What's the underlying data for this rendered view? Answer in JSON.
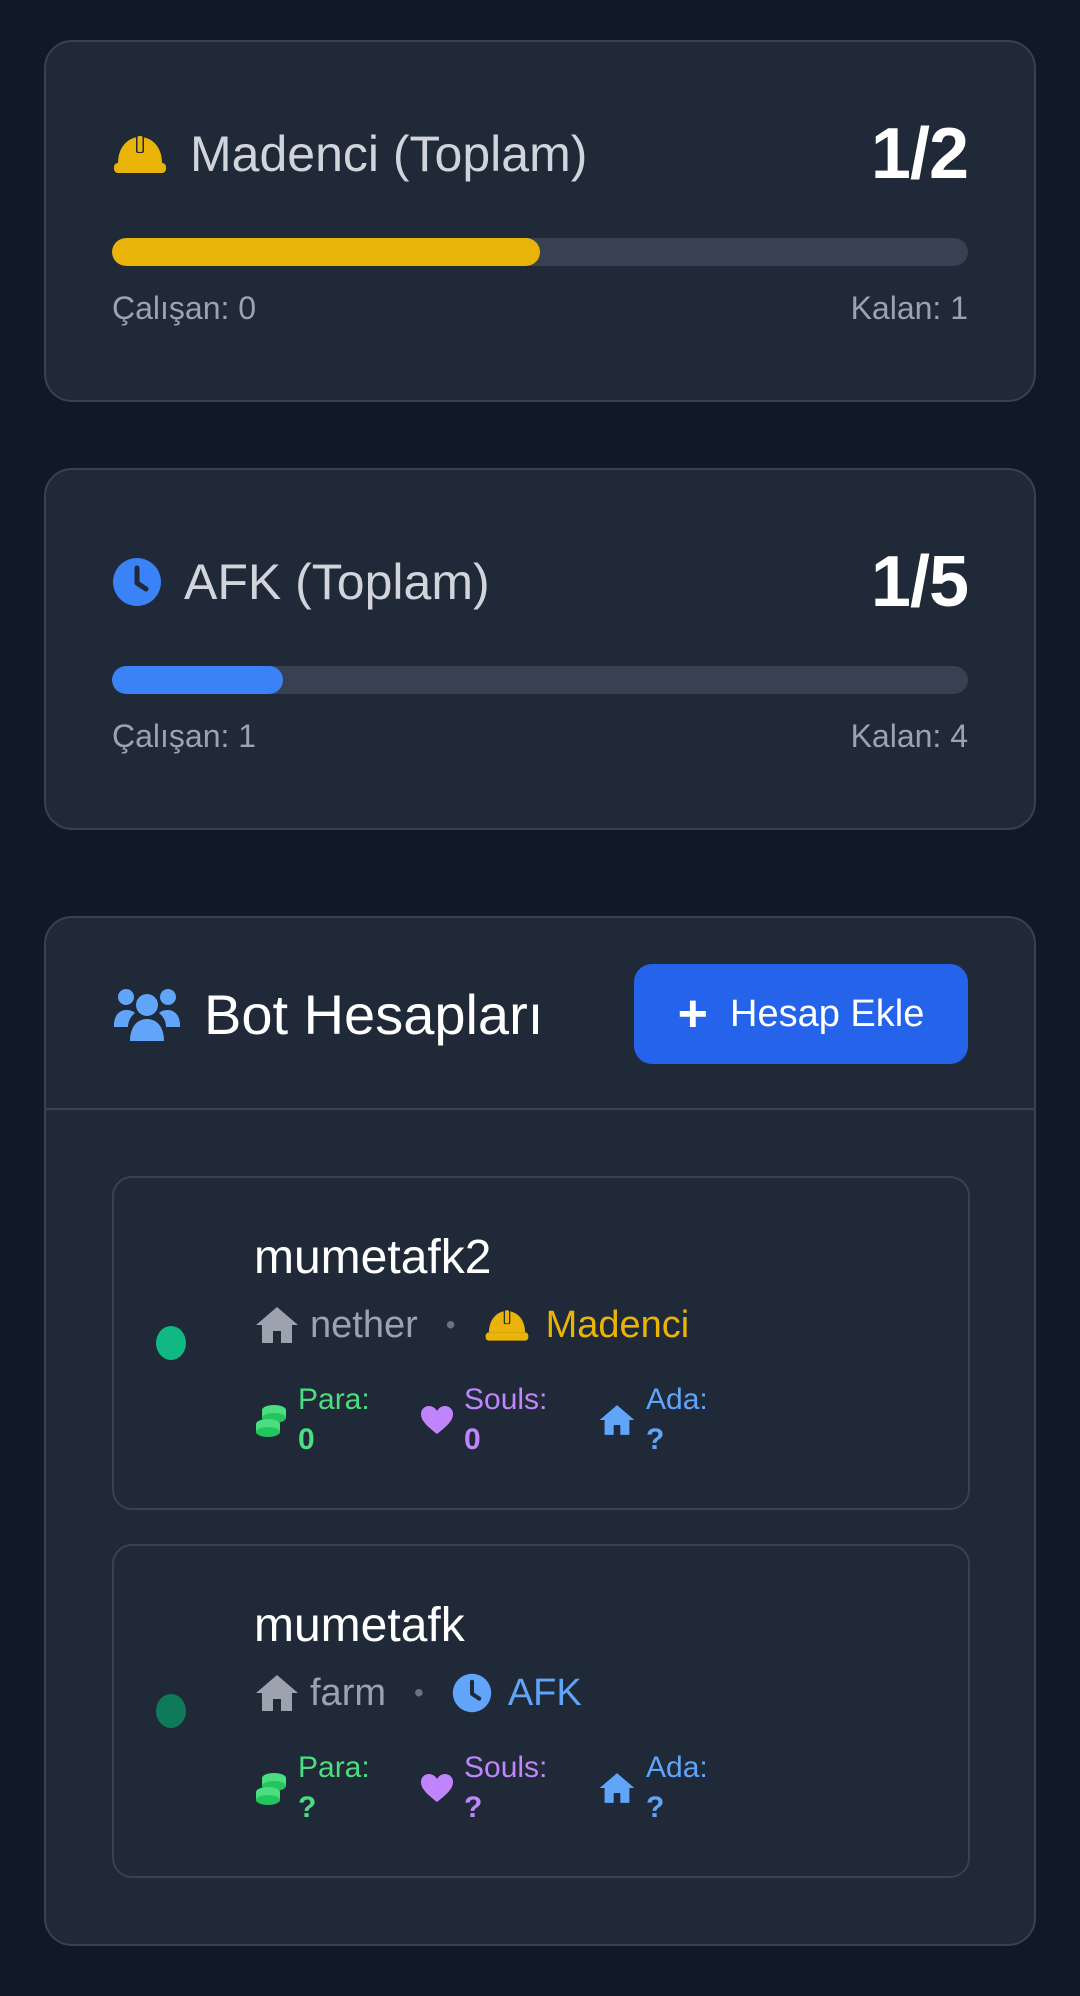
{
  "stats": [
    {
      "title": "Madenci (Toplam)",
      "value": "1/2",
      "fill_fraction": 0.5,
      "bar_color": "#eab308",
      "icon": "hard-hat-icon",
      "icon_color": "#eab308",
      "working_label": "Çalışan: 0",
      "remaining_label": "Kalan: 1"
    },
    {
      "title": "AFK (Toplam)",
      "value": "1/5",
      "fill_fraction": 0.2,
      "bar_color": "#3b82f6",
      "icon": "clock-icon",
      "icon_color": "#3b82f6",
      "working_label": "Çalışan: 1",
      "remaining_label": "Kalan: 4"
    }
  ],
  "bots_panel": {
    "title": "Bot Hesapları",
    "title_icon": "users-icon",
    "add_button_label": "Hesap Ekle",
    "add_button_icon": "plus-icon"
  },
  "bots": [
    {
      "name": "mumetafk2",
      "location": "nether",
      "role": "Madenci",
      "role_color": "#eab308",
      "status_color": "#10b981",
      "para_label": "Para:",
      "para_value": "0",
      "souls_label": "Souls:",
      "souls_value": "0",
      "ada_label": "Ada:",
      "ada_value": "?"
    },
    {
      "name": "mumetafk",
      "location": "farm",
      "role": "AFK",
      "role_color": "#60a5fa",
      "status_color": "#0f7a5a",
      "para_label": "Para:",
      "para_value": "?",
      "souls_label": "Souls:",
      "souls_value": "?",
      "ada_label": "Ada:",
      "ada_value": "?"
    }
  ],
  "colors": {
    "para": "#4ade80",
    "souls": "#c084fc",
    "ada": "#60a5fa",
    "accent": "#2563eb"
  }
}
